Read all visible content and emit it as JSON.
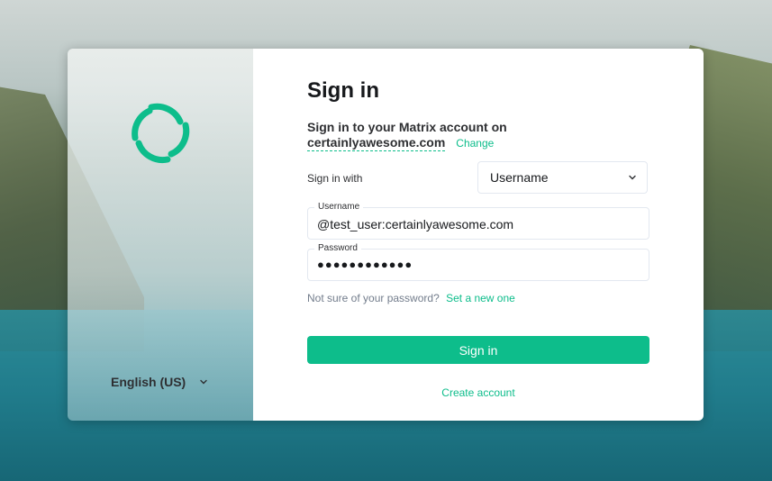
{
  "login": {
    "title": "Sign in",
    "subtitle": "Sign in to your Matrix account on",
    "server": "certainlyawesome.com",
    "change_link": "Change",
    "sign_in_with_label": "Sign in with",
    "sign_in_with_value": "Username",
    "username_label": "Username",
    "username_value": "@test_user:certainlyawesome.com",
    "password_label": "Password",
    "password_value": "●●●●●●●●●●●●",
    "forgot_prefix": "Not sure of your password?",
    "forgot_link": "Set a new one",
    "submit_label": "Sign in",
    "create_account": "Create account"
  },
  "language": {
    "selected": "English (US)"
  },
  "colors": {
    "accent": "#0dbd8b",
    "text": "#17191c",
    "muted": "#737d8c"
  },
  "icons": {
    "logo": "element-logo",
    "language_chevron": "chevron-down-icon",
    "select_chevron": "chevron-down-icon"
  }
}
